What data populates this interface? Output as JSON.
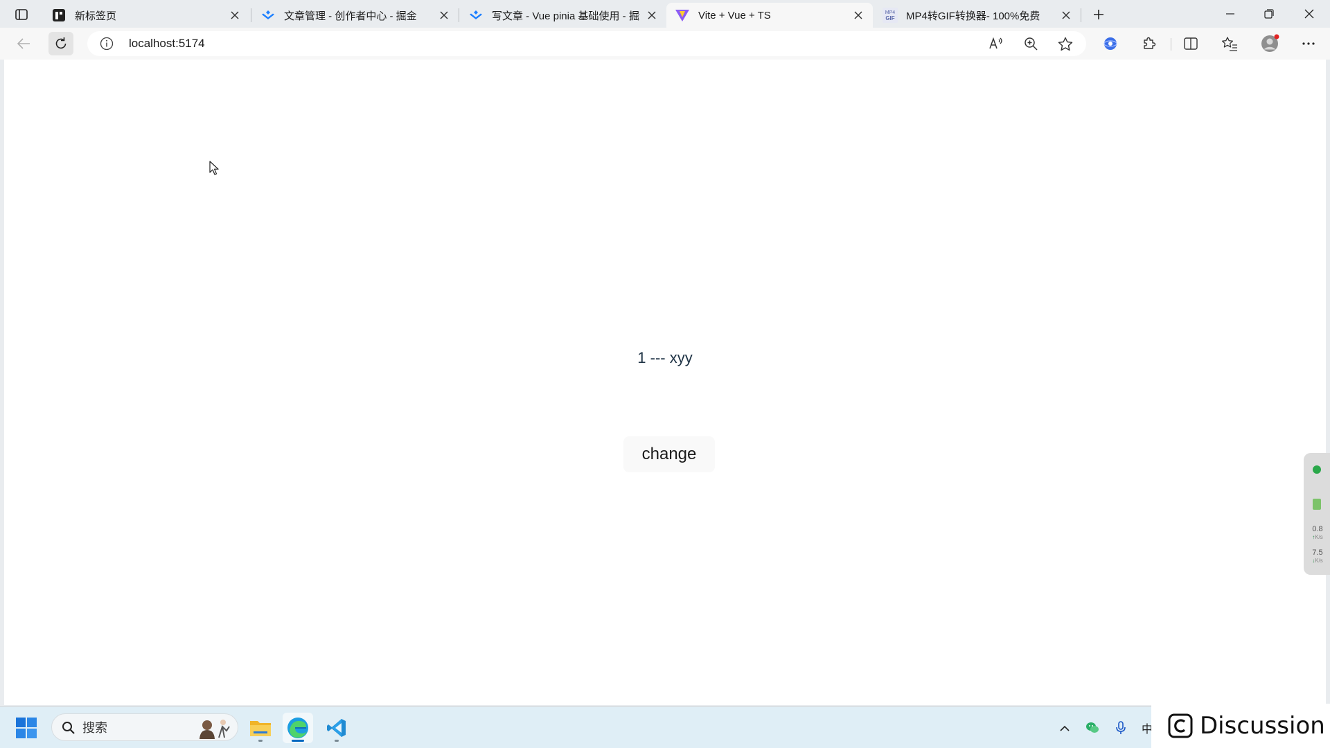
{
  "browser": {
    "tabs": [
      {
        "title": "新标签页",
        "active": false
      },
      {
        "title": "文章管理 - 创作者中心 - 掘金",
        "active": false
      },
      {
        "title": "写文章 - Vue pinia 基础使用 - 掘金",
        "active": false
      },
      {
        "title": "Vite + Vue + TS",
        "active": true
      },
      {
        "title": "MP4转GIF转换器- 100%免费",
        "active": false
      }
    ],
    "favicon_badge": "MP4 GIF",
    "address": "localhost:5174"
  },
  "page": {
    "count": "1",
    "separator": " --- ",
    "name": "xyy",
    "button_label": "change"
  },
  "net_monitor": {
    "upload": "0.8",
    "download": "7.5",
    "unit": "K/s"
  },
  "taskbar": {
    "search_placeholder": "搜索",
    "tray_ime": "中"
  },
  "overlay": {
    "label": "Discussion"
  },
  "colors": {
    "chrome_bg": "#e9ecef",
    "active_tab": "#f7f7f7",
    "page_bg": "#ffffff",
    "text_color": "#213547",
    "taskbar_bg": "#dfeef6",
    "accent": "#0067c0"
  }
}
